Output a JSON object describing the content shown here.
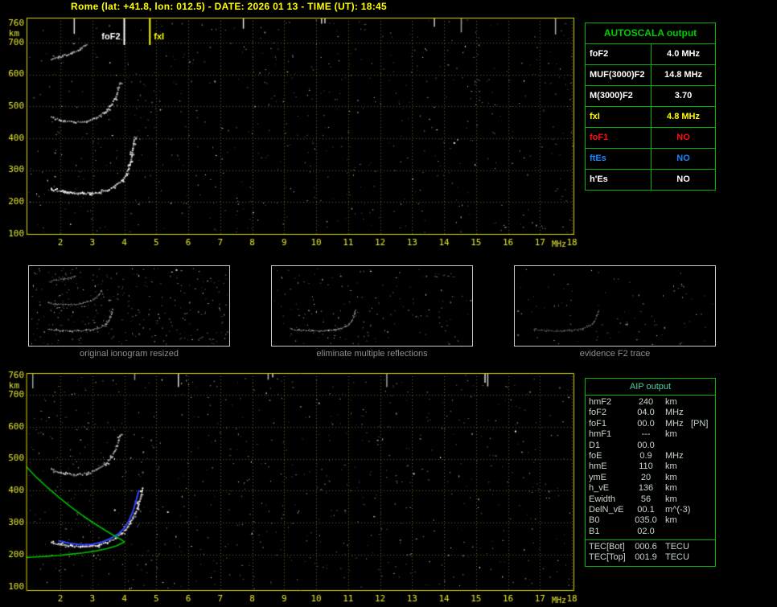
{
  "header": {
    "title": "Rome (lat: +41.8, lon: 012.5) - DATE: 2026 01 13 - TIME (UT): 18:45",
    "color": "#ffff00"
  },
  "autoscala": {
    "title": "AUTOSCALA output",
    "title_color": "#00cc00",
    "border_color": "#00b400",
    "rows": [
      {
        "label": "foF2",
        "value": "4.0 MHz",
        "color": "#ffffff"
      },
      {
        "label": "MUF(3000)F2",
        "value": "14.8 MHz",
        "color": "#ffffff"
      },
      {
        "label": "M(3000)F2",
        "value": "3.70",
        "color": "#ffffff"
      },
      {
        "label": "fxI",
        "value": "4.8 MHz",
        "color": "#ffff00"
      },
      {
        "label": "foF1",
        "value": "NO",
        "color": "#ff1010"
      },
      {
        "label": "ftEs",
        "value": "NO",
        "color": "#1c86ff"
      },
      {
        "label": "h'Es",
        "value": "NO",
        "color": "#ffffff"
      }
    ]
  },
  "aip": {
    "title": "AIP output",
    "title_color": "#55cc99",
    "border_color": "#00b400",
    "text_color": "#c9d6c9",
    "rows": [
      {
        "name": "hmF2",
        "value": "240",
        "unit": "km",
        "note": ""
      },
      {
        "name": "foF2",
        "value": "04.0",
        "unit": "MHz",
        "note": ""
      },
      {
        "name": "foF1",
        "value": "00.0",
        "unit": "MHz",
        "note": "[PN]"
      },
      {
        "name": "hmF1",
        "value": "---",
        "unit": "km",
        "note": ""
      },
      {
        "name": "D1",
        "value": "00.0",
        "unit": "",
        "note": ""
      },
      {
        "name": "foE",
        "value": "0.9",
        "unit": "MHz",
        "note": ""
      },
      {
        "name": "hmE",
        "value": "110",
        "unit": "km",
        "note": ""
      },
      {
        "name": "ymE",
        "value": "20",
        "unit": "km",
        "note": ""
      },
      {
        "name": "h_vE",
        "value": "136",
        "unit": "km",
        "note": ""
      },
      {
        "name": "Ewidth",
        "value": "56",
        "unit": "km",
        "note": ""
      },
      {
        "name": "DelN_vE",
        "value": "00.1",
        "unit": "m^(-3)",
        "note": ""
      },
      {
        "name": "B0",
        "value": "035.0",
        "unit": "km",
        "note": ""
      },
      {
        "name": "B1",
        "value": "02.0",
        "unit": "",
        "note": ""
      }
    ],
    "tec_rows": [
      {
        "name": "TEC[Bot]",
        "value": "000.6",
        "unit": "TECU"
      },
      {
        "name": "TEC[Top]",
        "value": "001.9",
        "unit": "TECU"
      }
    ]
  },
  "thumbnails": [
    {
      "caption": "original ionogram resized"
    },
    {
      "caption": "eliminate multiple reflections"
    },
    {
      "caption": "evidence F2 trace"
    }
  ],
  "chart_data": [
    {
      "id": "ionogram_top",
      "type": "scatter",
      "title": "",
      "xlabel": "MHz",
      "ylabel": "km",
      "xlim": [
        0.94,
        18.05
      ],
      "ylim": [
        100,
        777
      ],
      "x_ticks": [
        2,
        3,
        4,
        5,
        6,
        7,
        8,
        9,
        10,
        11,
        12,
        13,
        14,
        15,
        16,
        17,
        18
      ],
      "y_ticks": [
        760,
        700,
        600,
        500,
        400,
        300,
        200,
        100
      ],
      "grid": true,
      "axis_color": "#e6e630",
      "grid_color": "#6a6a28",
      "border_color": "#d4d400",
      "markers": [
        {
          "label": "foF2",
          "freq_mhz": 4.0,
          "color": "#ffffff",
          "label_side": "left"
        },
        {
          "label": "fxI",
          "freq_mhz": 4.8,
          "color": "#ffff00",
          "label_side": "right"
        }
      ],
      "traces": [
        {
          "name": "F trace 1st hop",
          "style": "dots",
          "color": "#ffffff",
          "size": 2,
          "points": [
            [
              1.7,
              242
            ],
            [
              2.0,
              235
            ],
            [
              2.3,
              231
            ],
            [
              2.6,
              229
            ],
            [
              2.9,
              229
            ],
            [
              3.2,
              233
            ],
            [
              3.45,
              240
            ],
            [
              3.7,
              252
            ],
            [
              3.9,
              268
            ],
            [
              4.05,
              290
            ],
            [
              4.15,
              315
            ],
            [
              4.22,
              350
            ],
            [
              4.27,
              385
            ],
            [
              4.3,
              405
            ]
          ]
        },
        {
          "name": "F trace 2nd hop",
          "style": "dots",
          "color": "#d2d2d2",
          "size": 2,
          "points": [
            [
              1.7,
              468
            ],
            [
              2.0,
              458
            ],
            [
              2.4,
              452
            ],
            [
              2.8,
              455
            ],
            [
              3.1,
              466
            ],
            [
              3.4,
              485
            ],
            [
              3.6,
              510
            ],
            [
              3.75,
              540
            ],
            [
              3.85,
              575
            ]
          ]
        },
        {
          "name": "F trace 3rd hop",
          "style": "dots",
          "color": "#b8b8b8",
          "size": 2,
          "points": [
            [
              1.75,
              652
            ],
            [
              2.05,
              660
            ],
            [
              2.35,
              670
            ],
            [
              2.6,
              682
            ],
            [
              2.8,
              695
            ]
          ]
        }
      ],
      "noise": {
        "dots": 620,
        "streaks": 7,
        "seed": 20260113
      }
    },
    {
      "id": "ionogram_bottom",
      "type": "scatter",
      "title": "",
      "xlabel": "MHz",
      "ylabel": "km",
      "xlim": [
        0.94,
        18.05
      ],
      "ylim": [
        100,
        777
      ],
      "x_ticks": [
        2,
        3,
        4,
        5,
        6,
        7,
        8,
        9,
        10,
        11,
        12,
        13,
        14,
        15,
        16,
        17,
        18
      ],
      "y_ticks": [
        760,
        700,
        600,
        500,
        400,
        300,
        200,
        100
      ],
      "grid": true,
      "axis_color": "#e6e630",
      "grid_color": "#6a6a28",
      "border_color": "#d4d400",
      "markers": [],
      "traces": [
        {
          "name": "F trace 1st hop",
          "style": "dots",
          "color": "#ffffff",
          "size": 2,
          "points": [
            [
              1.7,
              242
            ],
            [
              2.0,
              235
            ],
            [
              2.3,
              231
            ],
            [
              2.6,
              229
            ],
            [
              2.9,
              229
            ],
            [
              3.2,
              233
            ],
            [
              3.45,
              240
            ],
            [
              3.7,
              252
            ],
            [
              3.9,
              268
            ],
            [
              4.1,
              292
            ],
            [
              4.25,
              318
            ],
            [
              4.4,
              350
            ],
            [
              4.5,
              385
            ],
            [
              4.55,
              410
            ]
          ]
        },
        {
          "name": "F trace 2nd hop",
          "style": "dots",
          "color": "#c8c8c8",
          "size": 2,
          "points": [
            [
              1.7,
              468
            ],
            [
              2.0,
              458
            ],
            [
              2.4,
              452
            ],
            [
              2.8,
              455
            ],
            [
              3.1,
              466
            ],
            [
              3.4,
              485
            ],
            [
              3.6,
              510
            ],
            [
              3.75,
              540
            ],
            [
              3.85,
              575
            ]
          ]
        },
        {
          "name": "fitted F2 trace",
          "style": "line",
          "color": "#3344ff",
          "size": 2,
          "points": [
            [
              1.95,
              244
            ],
            [
              2.3,
              236
            ],
            [
              2.7,
              231
            ],
            [
              3.0,
              233
            ],
            [
              3.3,
              240
            ],
            [
              3.55,
              250
            ],
            [
              3.8,
              264
            ],
            [
              4.0,
              283
            ],
            [
              4.15,
              307
            ],
            [
              4.28,
              338
            ],
            [
              4.38,
              372
            ],
            [
              4.45,
              400
            ]
          ]
        },
        {
          "name": "electron density profile topside",
          "style": "line",
          "color": "#00bb00",
          "size": 1.6,
          "points": [
            [
              0.95,
              474
            ],
            [
              1.25,
              442
            ],
            [
              1.6,
              410
            ],
            [
              1.95,
              380
            ],
            [
              2.3,
              352
            ],
            [
              2.65,
              326
            ],
            [
              3.0,
              302
            ],
            [
              3.35,
              280
            ],
            [
              3.65,
              262
            ],
            [
              3.9,
              248
            ],
            [
              4.0,
              240
            ]
          ]
        },
        {
          "name": "electron density profile bottomside",
          "style": "line",
          "color": "#00bb00",
          "size": 1.6,
          "points": [
            [
              4.0,
              240
            ],
            [
              3.75,
              228
            ],
            [
              3.45,
              219
            ],
            [
              3.1,
              212
            ],
            [
              2.7,
              206
            ],
            [
              2.3,
              202
            ],
            [
              1.9,
              198
            ],
            [
              1.5,
              195
            ],
            [
              1.1,
              193
            ],
            [
              0.95,
              192
            ]
          ]
        }
      ],
      "noise": {
        "dots": 700,
        "streaks": 8,
        "seed": 777
      }
    },
    {
      "id": "thumb_original",
      "type": "scatter",
      "source": "ionogram_top",
      "trace_indices": [
        0,
        1,
        2
      ],
      "trace_alpha": 1,
      "noise": {
        "dots": 300,
        "streaks": 0,
        "seed": 11
      }
    },
    {
      "id": "thumb_clean",
      "type": "scatter",
      "source": "ionogram_top",
      "trace_indices": [
        0
      ],
      "trace_alpha": 0.9,
      "noise": {
        "dots": 160,
        "streaks": 0,
        "seed": 22
      }
    },
    {
      "id": "thumb_f2",
      "type": "scatter",
      "source": "ionogram_top",
      "trace_indices": [
        0
      ],
      "trace_alpha": 0.6,
      "noise": {
        "dots": 90,
        "streaks": 0,
        "seed": 33
      }
    }
  ]
}
